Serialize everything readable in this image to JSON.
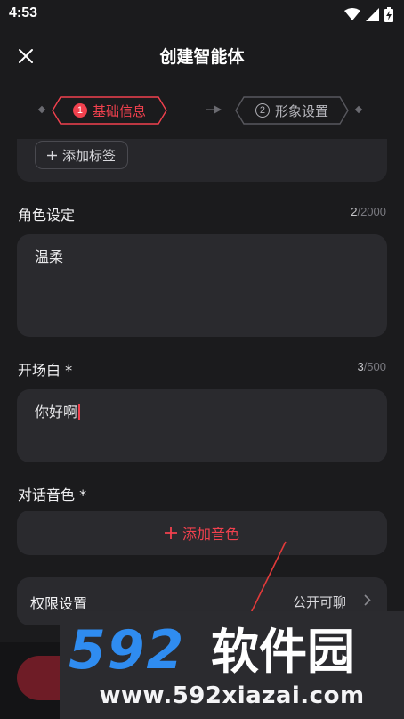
{
  "status_bar": {
    "time": "4:53",
    "icons": [
      "wifi-icon",
      "cellular-signal-icon",
      "battery-charging-icon"
    ]
  },
  "header": {
    "title": "创建智能体",
    "close_icon": "close-icon"
  },
  "steps": [
    {
      "number": "1",
      "label": "基础信息",
      "active": true
    },
    {
      "number": "2",
      "label": "形象设置",
      "active": false
    }
  ],
  "tags": {
    "add_label": "添加标签"
  },
  "role": {
    "label": "角色设定",
    "count_current": "2",
    "count_max": "/2000",
    "value": "温柔"
  },
  "opening": {
    "label": "开场白 *",
    "count_current": "3",
    "count_max": "/500",
    "value": "你好啊"
  },
  "voice": {
    "label": "对话音色 *",
    "add_label": "添加音色"
  },
  "permission": {
    "label": "权限设置",
    "value": "公开可聊"
  },
  "watermark": {
    "logo_text": "592软件园",
    "url": "www.592xiazai.com"
  },
  "colors": {
    "accent": "#f2414e",
    "background": "#1b1b1d",
    "card": "#2a2a2e",
    "watermark_blue": "#2f8cf0"
  }
}
